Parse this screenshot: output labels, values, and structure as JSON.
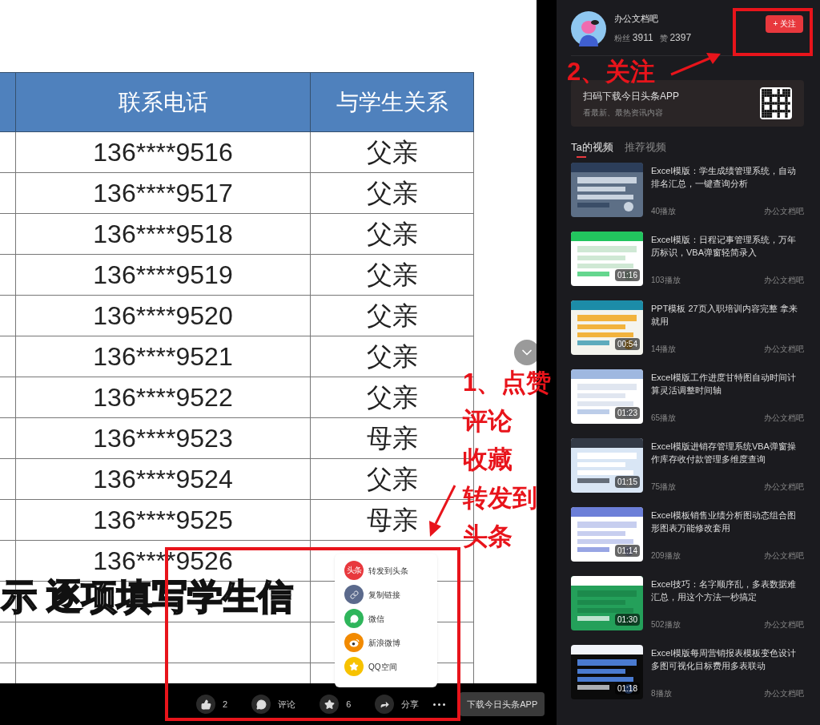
{
  "video": {
    "table": {
      "columns": [
        "联系电话",
        "与学生关系"
      ],
      "rows": [
        {
          "phone": "136****9516",
          "relation": "父亲"
        },
        {
          "phone": "136****9517",
          "relation": "父亲"
        },
        {
          "phone": "136****9518",
          "relation": "父亲"
        },
        {
          "phone": "136****9519",
          "relation": "父亲"
        },
        {
          "phone": "136****9520",
          "relation": "父亲"
        },
        {
          "phone": "136****9521",
          "relation": "父亲"
        },
        {
          "phone": "136****9522",
          "relation": "父亲"
        },
        {
          "phone": "136****9523",
          "relation": "母亲"
        },
        {
          "phone": "136****9524",
          "relation": "父亲"
        },
        {
          "phone": "136****9525",
          "relation": "母亲"
        },
        {
          "phone": "136****9526",
          "relation": ""
        }
      ]
    },
    "subtitle": "示 逐项填写学生信"
  },
  "share_menu": {
    "items": [
      {
        "label": "转发到头条",
        "kind": "toutiao",
        "badge": "头条",
        "color": "#e8383d"
      },
      {
        "label": "复制链接",
        "kind": "link",
        "color": "#5b6a8c"
      },
      {
        "label": "微信",
        "kind": "wechat",
        "color": "#2fb55b"
      },
      {
        "label": "新浪微博",
        "kind": "weibo",
        "color": "#f28a00"
      },
      {
        "label": "QQ空间",
        "kind": "qzone",
        "color": "#f7c200"
      }
    ]
  },
  "action_bar": {
    "items": [
      {
        "kind": "like",
        "label": "2"
      },
      {
        "kind": "comment",
        "label": "评论"
      },
      {
        "kind": "favorite",
        "label": "6"
      },
      {
        "kind": "share",
        "label": "分享"
      }
    ],
    "download_button": "下载今日头条APP"
  },
  "author": {
    "name": "办公文档吧",
    "fans_label": "粉丝",
    "fans": "3911",
    "likes_label": "赞",
    "likes": "2397",
    "follow_button": "+ 关注"
  },
  "app_promo": {
    "title": "扫码下载今日头条APP",
    "subtitle": "看最新、最热资讯内容"
  },
  "tabs": [
    {
      "label": "Ta的视频",
      "selected": true
    },
    {
      "label": "推荐视频",
      "selected": false
    }
  ],
  "videos": [
    {
      "title": "Excel模版：学生成绩管理系统，自动排名汇总，一键查询分析",
      "plays": "40播放",
      "author": "办公文档吧"
    },
    {
      "title": "Excel模版：日程记事管理系统，万年历标识，VBA弹窗轻简录入",
      "plays": "103播放",
      "author": "办公文档吧",
      "duration": "01:16"
    },
    {
      "title": "PPT模板 27页入职培训内容完整 拿来就用",
      "plays": "14播放",
      "author": "办公文档吧",
      "duration": "00:54"
    },
    {
      "title": "Excel模版工作进度甘特图自动时间计算灵活调整时间轴",
      "plays": "65播放",
      "author": "办公文档吧",
      "duration": "01:23"
    },
    {
      "title": "Excel模版进销存管理系统VBA弹窗操作库存收付款管理多维度查询",
      "plays": "75播放",
      "author": "办公文档吧",
      "duration": "01:15"
    },
    {
      "title": "Excel模板销售业绩分析图动态组合图形图表万能修改套用",
      "plays": "209播放",
      "author": "办公文档吧",
      "duration": "01:14"
    },
    {
      "title": "Excel技巧：名字顺序乱，多表数据难汇总，用这个方法一秒搞定",
      "plays": "502播放",
      "author": "办公文档吧",
      "duration": "01:30"
    },
    {
      "title": "Excel模版每周营销报表模板变色设计多图可视化目标费用多表联动",
      "plays": "8播放",
      "author": "办公文档吧",
      "duration": "01:18"
    }
  ],
  "annotations": [
    {
      "kind": "follow",
      "lines": [
        "2、关注"
      ]
    },
    {
      "kind": "actions",
      "lines": [
        "1、点赞",
        "评论",
        "收藏",
        "转发到",
        "头条"
      ]
    }
  ]
}
